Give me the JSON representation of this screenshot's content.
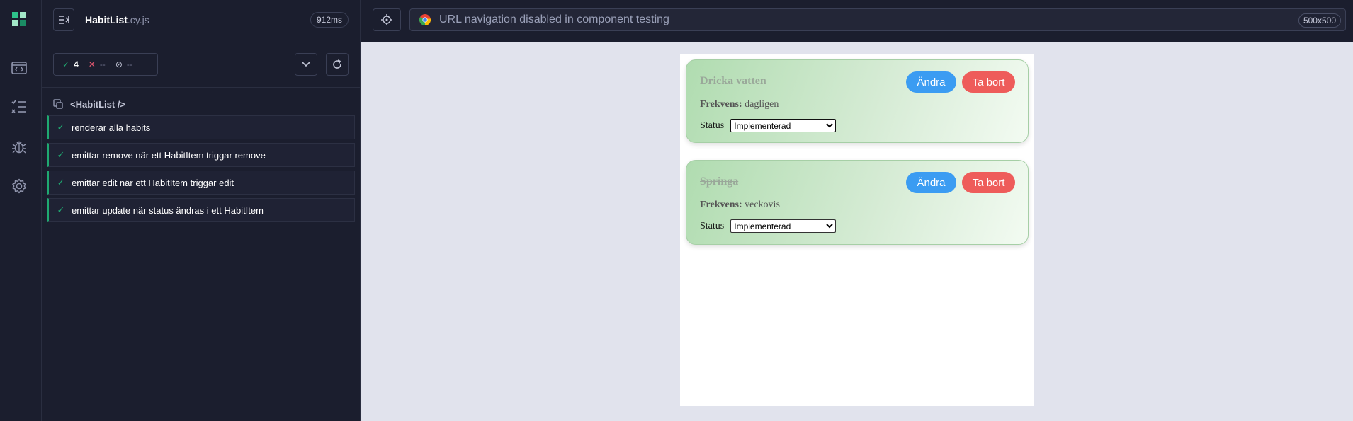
{
  "sidebar": {
    "icons": [
      "cypress-logo-icon",
      "specs-icon",
      "runs-icon",
      "debug-icon",
      "settings-icon"
    ]
  },
  "spec": {
    "name": "HabitList",
    "extension": ".cy.js",
    "duration": "912ms"
  },
  "stats": {
    "passed": "4",
    "failed": "--",
    "pending": "--"
  },
  "suite": {
    "title": "<HabitList />",
    "tests": [
      {
        "title": "renderar alla habits",
        "state": "passed"
      },
      {
        "title": "emittar remove när ett HabitItem triggar remove",
        "state": "passed"
      },
      {
        "title": "emittar edit när ett HabitItem triggar edit",
        "state": "passed"
      },
      {
        "title": "emittar update när status ändras i ett HabitItem",
        "state": "passed"
      }
    ]
  },
  "urlbar": {
    "text": "URL navigation disabled in component testing",
    "viewport": "500x500"
  },
  "colors": {
    "passed": "#1fa971",
    "failed": "#e45770",
    "edit_button": "#3b9cf2",
    "delete_button": "#ee5c5a"
  },
  "habits": [
    {
      "name": "Dricka vatten",
      "edit_label": "Ändra",
      "delete_label": "Ta bort",
      "frequency_label": "Frekvens:",
      "frequency": "dagligen",
      "status_label": "Status",
      "status": "Implementerad"
    },
    {
      "name": "Springa",
      "edit_label": "Ändra",
      "delete_label": "Ta bort",
      "frequency_label": "Frekvens:",
      "frequency": "veckovis",
      "status_label": "Status",
      "status": "Implementerad"
    }
  ]
}
